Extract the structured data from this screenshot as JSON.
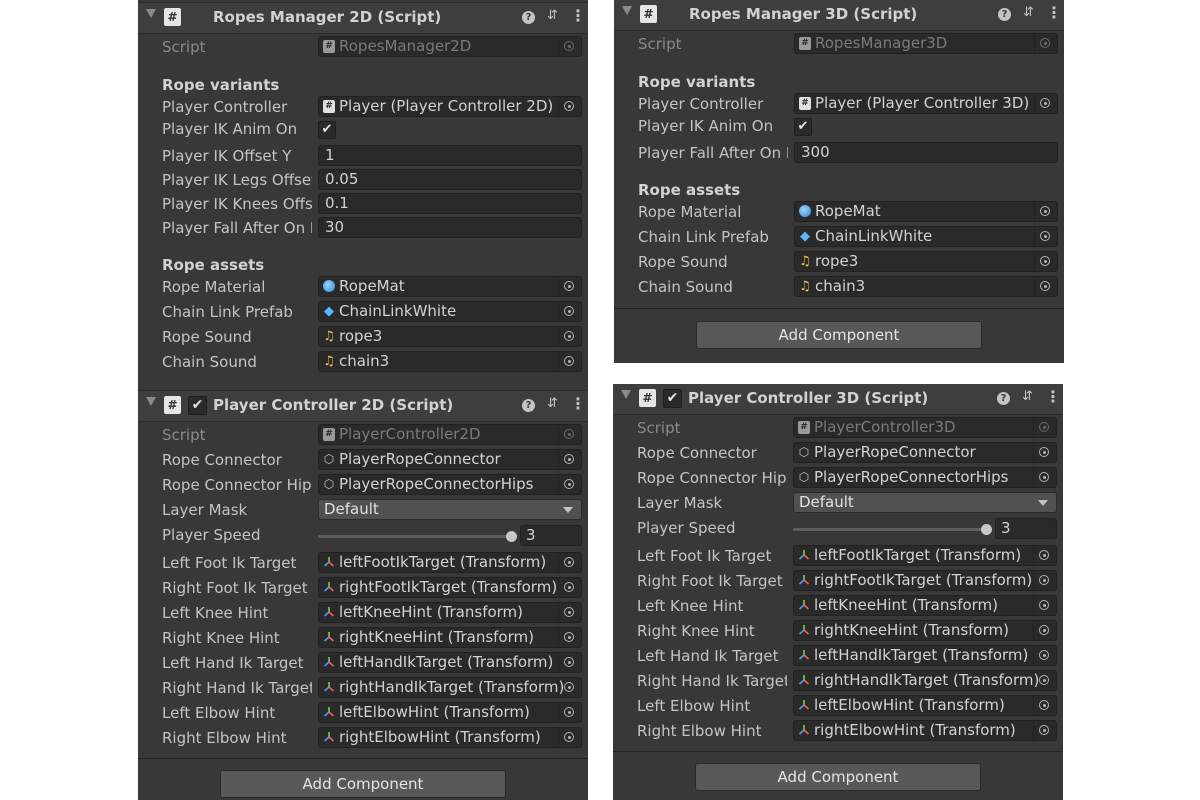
{
  "ropes2d": {
    "title": "Ropes Manager 2D (Script)",
    "script_label": "Script",
    "script_value": "RopesManager2D",
    "section_variants": "Rope variants",
    "player_controller_label": "Player Controller",
    "player_controller_value": "Player (Player Controller 2D)",
    "ik_anim_label": "Player IK Anim On",
    "ik_anim_checked": "✔",
    "ik_offset_y_label": "Player IK Offset Y",
    "ik_offset_y_value": "1",
    "ik_legs_label": "Player IK Legs Offset",
    "ik_legs_value": "0.05",
    "ik_knees_label": "Player IK Knees Offset",
    "ik_knees_value": "0.1",
    "fall_label": "Player Fall After On Rope",
    "fall_value": "30",
    "section_assets": "Rope assets",
    "rope_material_label": "Rope Material",
    "rope_material_value": "RopeMat",
    "chain_prefab_label": "Chain Link Prefab",
    "chain_prefab_value": "ChainLinkWhite",
    "rope_sound_label": "Rope Sound",
    "rope_sound_value": "rope3",
    "chain_sound_label": "Chain Sound",
    "chain_sound_value": "chain3"
  },
  "pc2d": {
    "title": "Player Controller 2D (Script)",
    "enabled": "✔",
    "script_label": "Script",
    "script_value": "PlayerController2D",
    "rope_connector_label": "Rope Connector",
    "rope_connector_value": "PlayerRopeConnector",
    "rope_hips_label": "Rope Connector Hips",
    "rope_hips_value": "PlayerRopeConnectorHips",
    "layer_mask_label": "Layer Mask",
    "layer_mask_value": "Default",
    "speed_label": "Player Speed",
    "speed_value": "3",
    "speed_fraction": 1.0,
    "fields": [
      {
        "label": "Left Foot Ik Target",
        "value": "leftFootIkTarget (Transform)"
      },
      {
        "label": "Right Foot Ik Target",
        "value": "rightFootIkTarget (Transform)"
      },
      {
        "label": "Left Knee Hint",
        "value": "leftKneeHint (Transform)"
      },
      {
        "label": "Right Knee Hint",
        "value": "rightKneeHint (Transform)"
      },
      {
        "label": "Left Hand Ik Target",
        "value": "leftHandIkTarget (Transform)"
      },
      {
        "label": "Right Hand Ik Target",
        "value": "rightHandIkTarget (Transform)"
      },
      {
        "label": "Left Elbow Hint",
        "value": "leftElbowHint (Transform)"
      },
      {
        "label": "Right Elbow Hint",
        "value": "rightElbowHint (Transform)"
      }
    ],
    "add_component": "Add Component"
  },
  "ropes3d": {
    "title": "Ropes Manager 3D (Script)",
    "script_label": "Script",
    "script_value": "RopesManager3D",
    "section_variants": "Rope variants",
    "player_controller_label": "Player Controller",
    "player_controller_value": "Player (Player Controller 3D)",
    "ik_anim_label": "Player IK Anim On",
    "ik_anim_checked": "✔",
    "fall_label": "Player Fall After On Rope",
    "fall_value": "300",
    "section_assets": "Rope assets",
    "rope_material_label": "Rope Material",
    "rope_material_value": "RopeMat",
    "chain_prefab_label": "Chain Link Prefab",
    "chain_prefab_value": "ChainLinkWhite",
    "rope_sound_label": "Rope Sound",
    "rope_sound_value": "rope3",
    "chain_sound_label": "Chain Sound",
    "chain_sound_value": "chain3",
    "add_component": "Add Component"
  },
  "pc3d": {
    "title": "Player Controller 3D (Script)",
    "enabled": "✔",
    "script_label": "Script",
    "script_value": "PlayerController3D",
    "rope_connector_label": "Rope Connector",
    "rope_connector_value": "PlayerRopeConnector",
    "rope_hips_label": "Rope Connector Hips",
    "rope_hips_value": "PlayerRopeConnectorHips",
    "layer_mask_label": "Layer Mask",
    "layer_mask_value": "Default",
    "speed_label": "Player Speed",
    "speed_value": "3",
    "speed_fraction": 1.0,
    "fields": [
      {
        "label": "Left Foot Ik Target",
        "value": "leftFootIkTarget (Transform)"
      },
      {
        "label": "Right Foot Ik Target",
        "value": "rightFootIkTarget (Transform)"
      },
      {
        "label": "Left Knee Hint",
        "value": "leftKneeHint (Transform)"
      },
      {
        "label": "Right Knee Hint",
        "value": "rightKneeHint (Transform)"
      },
      {
        "label": "Left Hand Ik Target",
        "value": "leftHandIkTarget (Transform)"
      },
      {
        "label": "Right Hand Ik Target",
        "value": "rightHandIkTarget (Transform)"
      },
      {
        "label": "Left Elbow Hint",
        "value": "leftElbowHint (Transform)"
      },
      {
        "label": "Right Elbow Hint",
        "value": "rightElbowHint (Transform)"
      }
    ],
    "add_component": "Add Component"
  },
  "icons": {
    "help": "?",
    "preset": "⇵",
    "more": "⋮",
    "script_hash": "#",
    "prefab": "◆",
    "audio": "♫",
    "gameobject": "⬡",
    "transform": "⟡"
  },
  "colors": {
    "panel_bg": "#383838",
    "header_bg": "#3e3e3e",
    "field_bg": "#2a2a2a",
    "button_bg": "#585858"
  }
}
